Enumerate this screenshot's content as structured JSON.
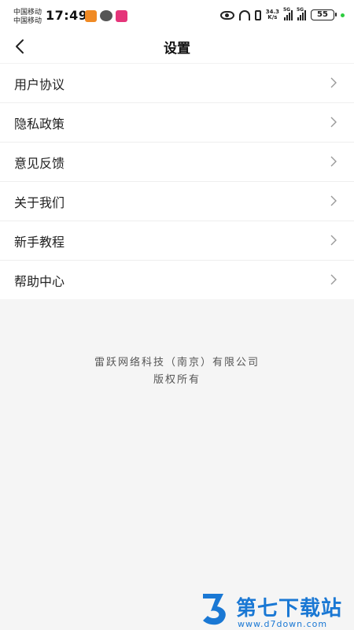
{
  "status_bar": {
    "carrier_1": "中国移动",
    "carrier_2": "中国移动",
    "time": "17:49",
    "net_speed_value": "34.3",
    "net_speed_unit": "K/s",
    "signal_1": "5G",
    "signal_2": "5G",
    "battery": "55"
  },
  "nav": {
    "title": "设置"
  },
  "menu": {
    "items": [
      {
        "label": "用户协议"
      },
      {
        "label": "隐私政策"
      },
      {
        "label": "意见反馈"
      },
      {
        "label": "关于我们"
      },
      {
        "label": "新手教程"
      },
      {
        "label": "帮助中心"
      }
    ]
  },
  "footer": {
    "company": "雷跃网络科技（南京）有限公司",
    "rights": "版权所有"
  },
  "watermark": {
    "title": "第七下载站",
    "url": "www.d7down.com"
  },
  "colors": {
    "background": "#f5f5f5",
    "surface": "#ffffff",
    "text": "#222222",
    "muted": "#555555",
    "chevron": "#999999",
    "watermark": "#1a78d4"
  }
}
